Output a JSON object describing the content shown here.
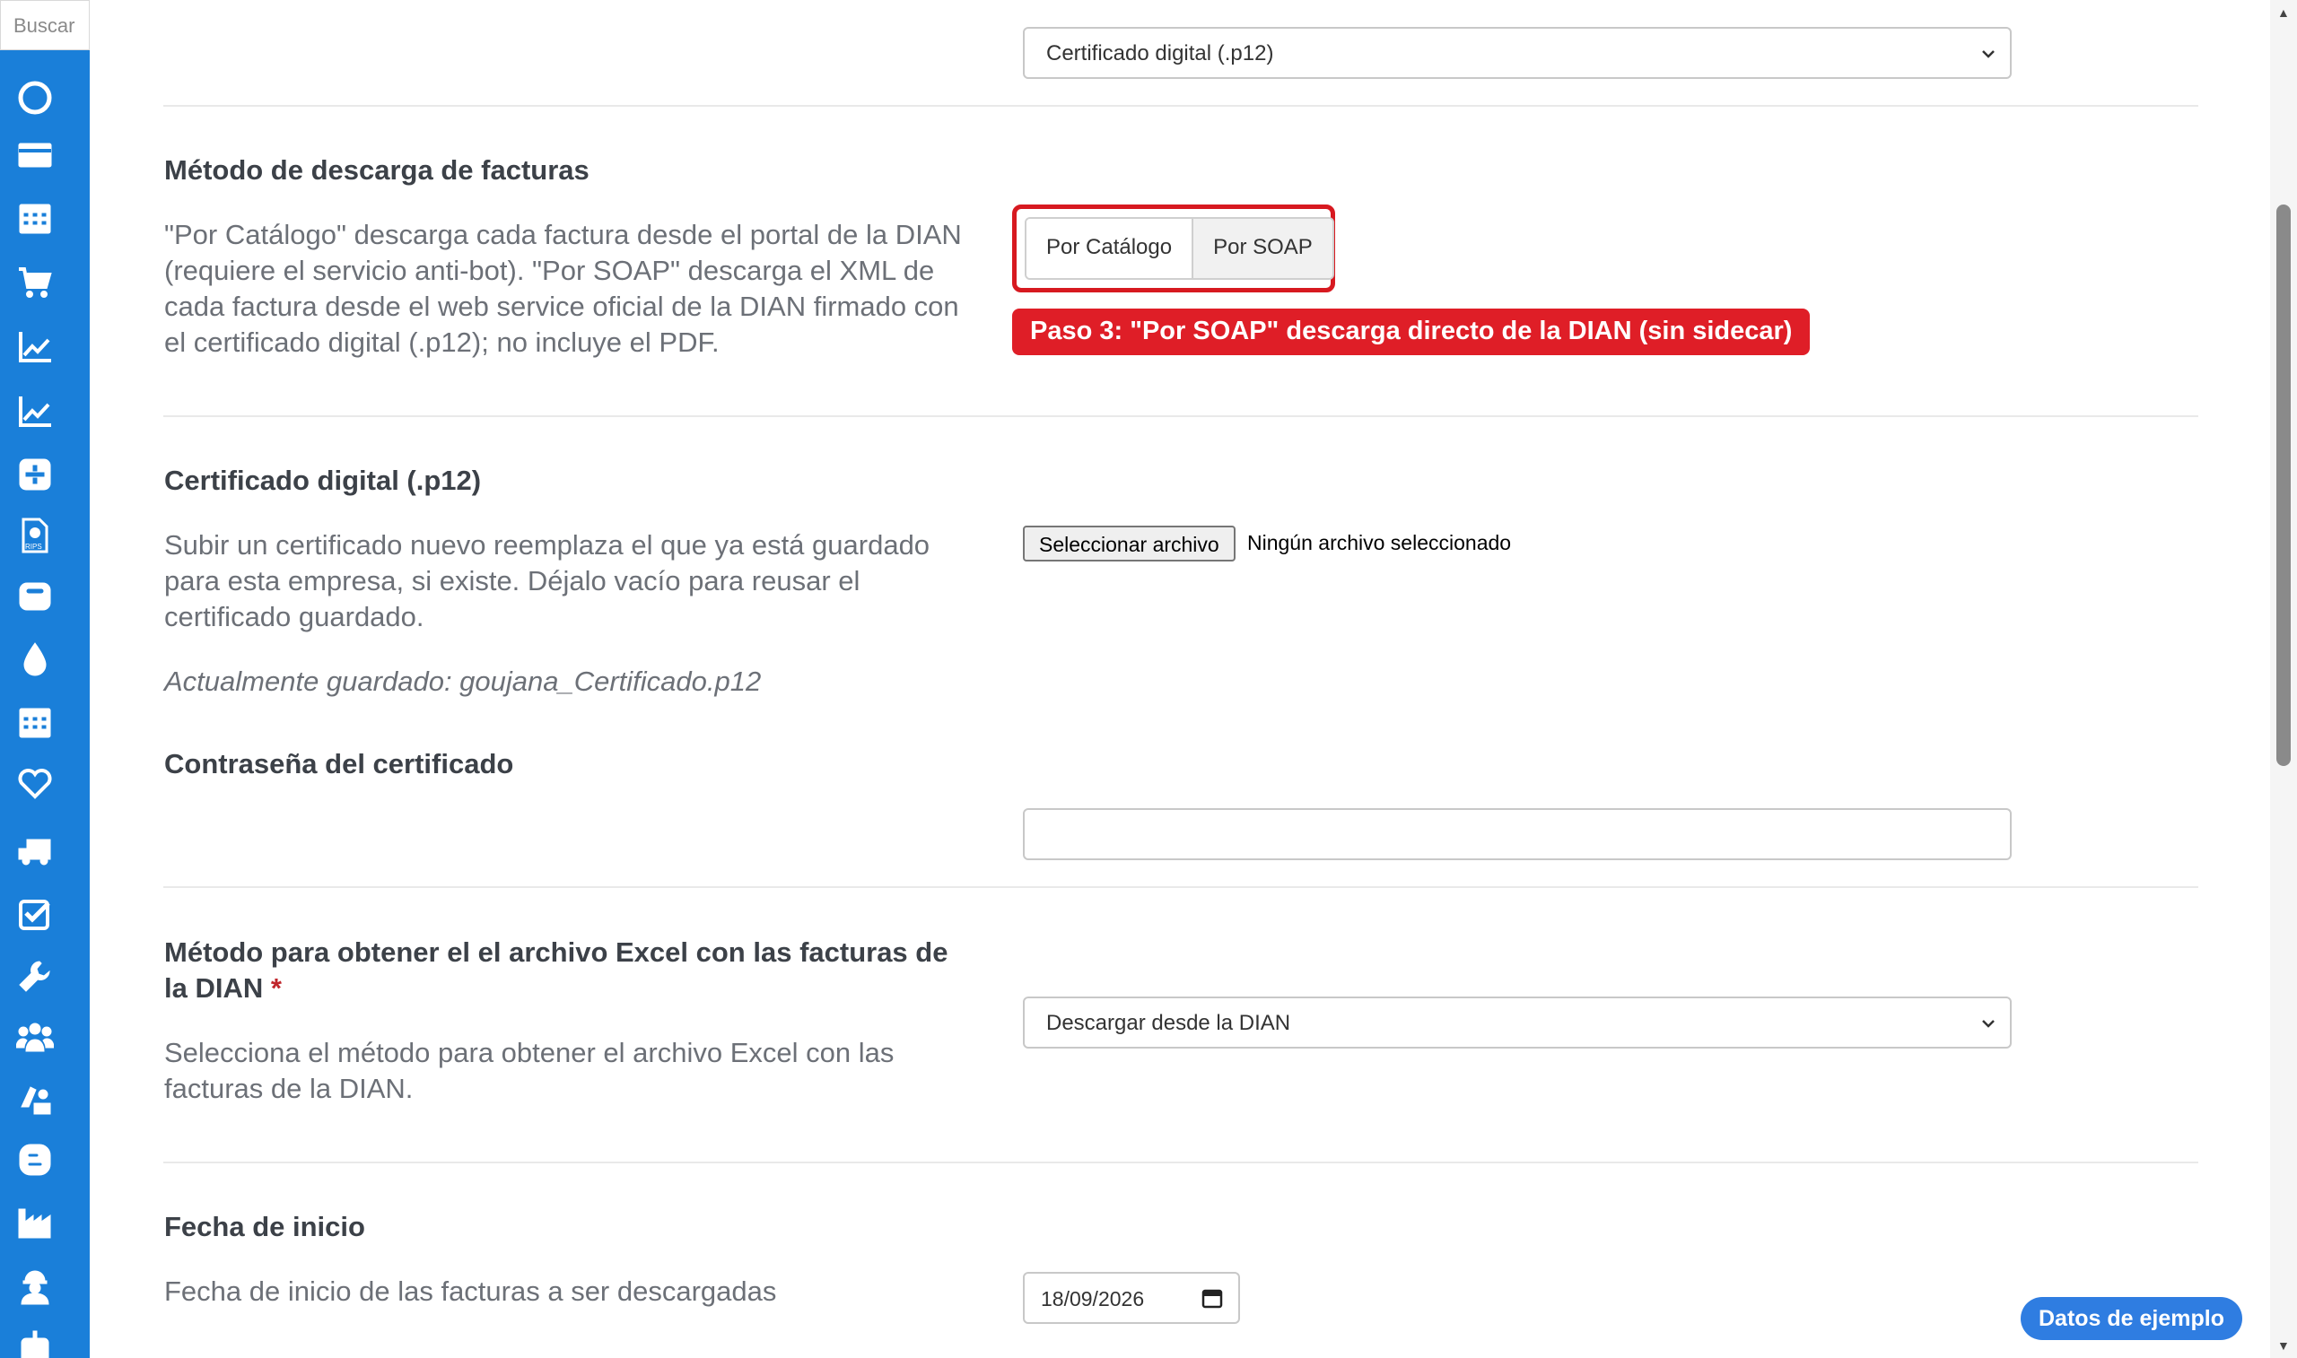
{
  "sidebar": {
    "search_placeholder": "Buscar",
    "icons": [
      "circle-icon",
      "card-icon",
      "calendar-icon",
      "cart-icon",
      "chart-line-icon",
      "chart-line-2-icon",
      "plus-square-icon",
      "rips-icon",
      "box-icon",
      "drop-icon",
      "calendar-2-icon",
      "heart-icon",
      "truck-icon",
      "checkbox-icon",
      "wrench-icon",
      "users-icon",
      "worker-icon",
      "blogger-icon",
      "factory-icon",
      "engineer-icon",
      "robot-icon"
    ]
  },
  "top_select": {
    "value": "Certificado digital (.p12)"
  },
  "metodo_descarga": {
    "title": "Método de descarga de facturas",
    "description_lines": [
      "\"Por Catálogo\" descarga cada factura desde el portal de la DIAN",
      "(requiere el servicio anti-bot). \"Por SOAP\" descarga el XML de",
      "cada factura desde el web service oficial de la DIAN firmado con",
      "el certificado digital (.p12); no incluye el PDF."
    ],
    "option_catalogo": "Por Catálogo",
    "option_soap": "Por SOAP",
    "annotation": "Paso 3: \"Por SOAP\" descarga directo de la DIAN (sin sidecar)"
  },
  "certificado": {
    "title": "Certificado digital (.p12)",
    "description_lines": [
      "Subir un certificado nuevo reemplaza el que ya está guardado",
      "para esta empresa, si existe. Déjalo vacío para reusar el",
      "certificado guardado."
    ],
    "current": "Actualmente guardado: goujana_Certificado.p12",
    "file_button": "Seleccionar archivo",
    "file_status": "Ningún archivo seleccionado"
  },
  "password": {
    "title": "Contraseña del certificado",
    "value": ""
  },
  "excel_method": {
    "title_line1": "Método para obtener el el archivo Excel con las facturas de",
    "title_line2": "la DIAN",
    "required_mark": "*",
    "description_lines": [
      "Selecciona el método para obtener el archivo Excel con las",
      "facturas de la DIAN."
    ],
    "value": "Descargar desde la DIAN"
  },
  "fecha_inicio": {
    "title": "Fecha de inicio",
    "description": "Fecha de inicio de las facturas a ser descargadas",
    "value": "18/09/2026"
  },
  "demo_badge": "Datos de ejemplo",
  "colors": {
    "sidebar": "#1a7fd9",
    "annotation_red": "#df1e27",
    "badge_blue": "#2f7de1"
  }
}
